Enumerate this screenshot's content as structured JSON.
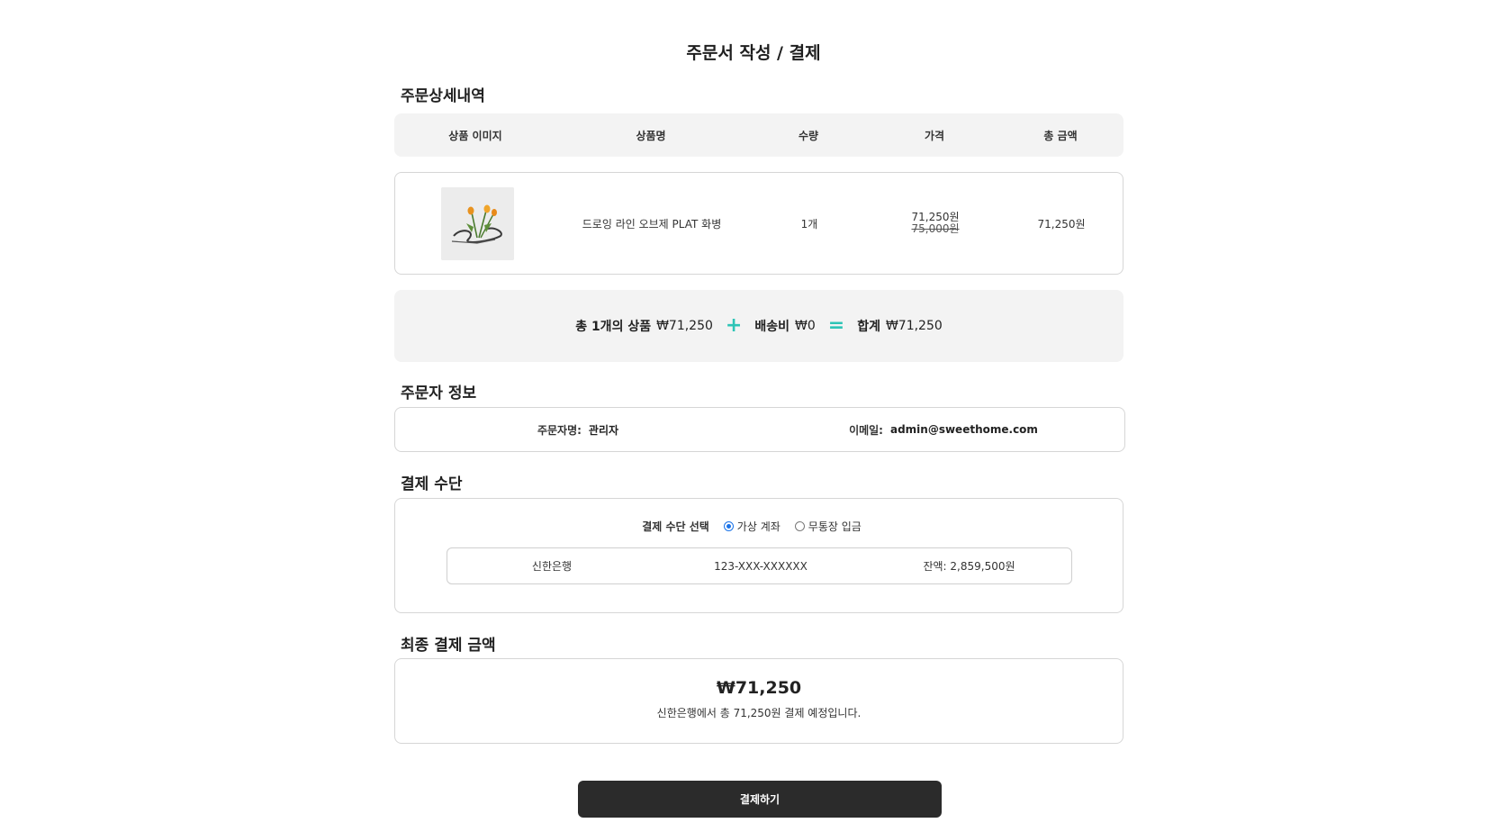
{
  "page": {
    "title": "주문서 작성 / 결제"
  },
  "sections": {
    "order_details": "주문상세내역",
    "orderer_info": "주문자 정보",
    "payment_method": "결제 수단",
    "final_amount": "최종 결제 금액"
  },
  "table": {
    "headers": [
      "상품 이미지",
      "상품명",
      "수량",
      "가격",
      "총 금액"
    ],
    "rows": [
      {
        "name": "드로잉 라인 오브제 PLAT 화병",
        "quantity": "1개",
        "price": "71,250원",
        "original_price": "75,000원",
        "total": "71,250원"
      }
    ]
  },
  "summary": {
    "items_label": "총 1개의 상품",
    "items_amount": "₩71,250",
    "plus": "+",
    "shipping_label": "배송비",
    "shipping_amount": "₩0",
    "equals": "=",
    "total_label": "합계",
    "total_amount": "₩71,250"
  },
  "orderer": {
    "name_label": "주문자명:",
    "name_value": "관리자",
    "email_label": "이메일:",
    "email_value": "admin@sweethome.com"
  },
  "payment": {
    "select_label": "결제 수단 선택",
    "options": [
      "가상 계좌",
      "무통장 입금"
    ],
    "selected": "가상 계좌",
    "account": {
      "bank": "신한은행",
      "number": "123-XXX-XXXXXX",
      "balance": "잔액: 2,859,500원"
    }
  },
  "final": {
    "amount": "₩71,250",
    "note": "신한은행에서 총 71,250원 결제 예정입니다."
  },
  "button": {
    "label": "결제하기"
  },
  "colors": {
    "accent_operator": "#2ec4b6",
    "button_bg": "#2b2b2b",
    "radio_checked": "#1a73e8"
  }
}
